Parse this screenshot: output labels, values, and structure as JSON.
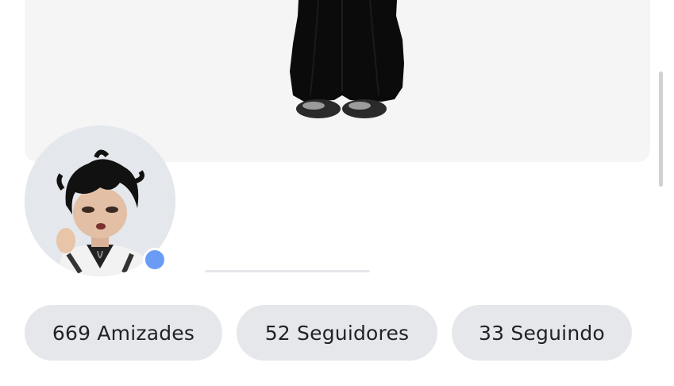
{
  "profile": {
    "stats": [
      {
        "label": "669 Amizades"
      },
      {
        "label": "52 Seguidores"
      },
      {
        "label": "33 Seguindo"
      }
    ],
    "presence_color": "#6a9cf5",
    "icons": {
      "fullbody": "avatar-fullbody-image",
      "headshot": "avatar-headshot-image",
      "presence": "online-presence-dot"
    }
  }
}
